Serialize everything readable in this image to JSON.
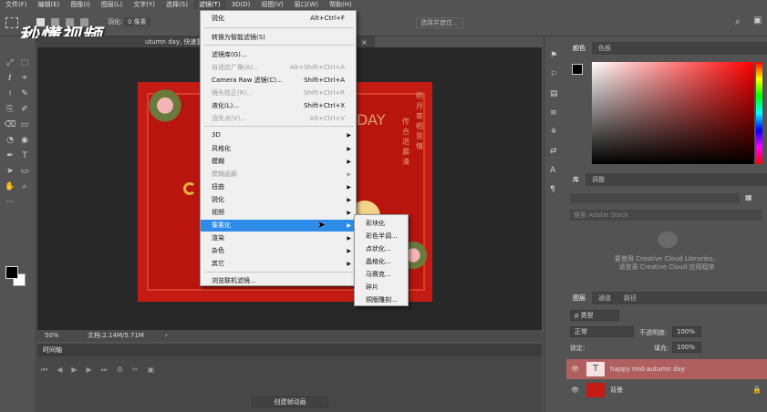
{
  "menubar": [
    "文件(F)",
    "编辑(E)",
    "图像(I)",
    "图层(L)",
    "文字(Y)",
    "选择(S)",
    "滤镜(T)",
    "3D(D)",
    "视图(V)",
    "窗口(W)",
    "帮助(H)"
  ],
  "options": {
    "feather": "羽化:",
    "feather_value": "0 像素",
    "refine": "选择并遮住..."
  },
  "watermark": "秒懂视频",
  "doc_tab": "utumn day, 快速复制",
  "artwork": {
    "title_part": "DAY",
    "vertical_text": [
      "明",
      "月",
      "寄",
      "相",
      "思",
      "情"
    ],
    "vertical_text2": [
      "传",
      "合",
      "逝",
      "晨",
      "清"
    ]
  },
  "filter_menu": {
    "items": [
      {
        "label": "锐化",
        "shortcut": "Alt+Ctrl+F",
        "disabled": false,
        "submenu": false
      },
      {
        "label": "转换为智能滤镜(S)",
        "shortcut": "",
        "disabled": false,
        "submenu": false
      },
      {
        "label": "滤镜库(G)...",
        "shortcut": "",
        "disabled": false,
        "submenu": false
      },
      {
        "label": "自适应广角(A)...",
        "shortcut": "Alt+Shift+Ctrl+A",
        "disabled": true,
        "submenu": false
      },
      {
        "label": "Camera Raw 滤镜(C)...",
        "shortcut": "Shift+Ctrl+A",
        "disabled": false,
        "submenu": false
      },
      {
        "label": "镜头校正(R)...",
        "shortcut": "Shift+Ctrl+R",
        "disabled": true,
        "submenu": false
      },
      {
        "label": "液化(L)...",
        "shortcut": "Shift+Ctrl+X",
        "disabled": false,
        "submenu": false
      },
      {
        "label": "消失点(V)...",
        "shortcut": "Alt+Ctrl+V",
        "disabled": true,
        "submenu": false
      },
      {
        "label": "3D",
        "shortcut": "",
        "disabled": false,
        "submenu": true
      },
      {
        "label": "风格化",
        "shortcut": "",
        "disabled": false,
        "submenu": true
      },
      {
        "label": "模糊",
        "shortcut": "",
        "disabled": false,
        "submenu": true
      },
      {
        "label": "模糊画廊",
        "shortcut": "",
        "disabled": true,
        "submenu": true
      },
      {
        "label": "扭曲",
        "shortcut": "",
        "disabled": false,
        "submenu": true
      },
      {
        "label": "锐化",
        "shortcut": "",
        "disabled": false,
        "submenu": true
      },
      {
        "label": "视频",
        "shortcut": "",
        "disabled": false,
        "submenu": true
      },
      {
        "label": "像素化",
        "shortcut": "",
        "disabled": false,
        "submenu": true
      },
      {
        "label": "渲染",
        "shortcut": "",
        "disabled": false,
        "submenu": true
      },
      {
        "label": "杂色",
        "shortcut": "",
        "disabled": false,
        "submenu": true
      },
      {
        "label": "其它",
        "shortcut": "",
        "disabled": false,
        "submenu": true
      },
      {
        "label": "浏览联机滤镜...",
        "shortcut": "",
        "disabled": false,
        "submenu": false
      }
    ],
    "highlighted": "像素化"
  },
  "pixelate_submenu": [
    "彩块化",
    "彩色半调...",
    "点状化...",
    "晶格化...",
    "马赛克...",
    "碎片",
    "铜版雕刻..."
  ],
  "status": {
    "zoom": "50%",
    "doc": "文档:2.14M/5.71M"
  },
  "timeline": {
    "tab": "时间轴",
    "create_button": "创建帧动画"
  },
  "color_panel": {
    "tabs": [
      "颜色",
      "色板"
    ]
  },
  "library_panel": {
    "tabs": [
      "库",
      "调整"
    ],
    "search": "搜索 Adobe Stock",
    "cc_line1": "要使用 Creative Cloud Libraries，",
    "cc_line2": "请登录 Creative Cloud 应用程序"
  },
  "layers_panel": {
    "tabs": [
      "图层",
      "通道",
      "路径"
    ],
    "filter_label": "ρ 类型",
    "blend_mode": "正常",
    "opacity_label": "不透明度:",
    "opacity_value": "100%",
    "lock_label": "锁定:",
    "fill_label": "填充:",
    "fill_value": "100%",
    "layers": [
      {
        "name": "happy mid-autumn day",
        "type": "text",
        "selected": true
      },
      {
        "name": "背景",
        "type": "image",
        "selected": false
      }
    ]
  },
  "colors": {
    "menu_highlight": "#2e8be8",
    "layer_selected": "#b05f5f",
    "art_red": "#c41c14"
  }
}
